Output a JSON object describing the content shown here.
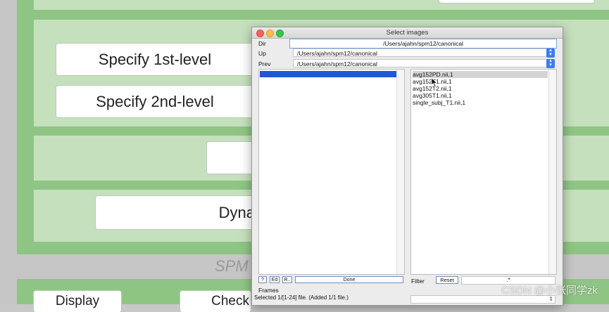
{
  "spm_panel": {
    "buttons": {
      "specify_1st": "Specify 1st-level",
      "specify_2nd": "Specify 2nd-level",
      "dyna": "Dyna",
      "display": "Display",
      "check": "Check"
    },
    "spm_label": "SPM"
  },
  "dialog": {
    "title": "Select images",
    "dir_label": "Dir",
    "dir_value": "/Users/ajahn/spm12/canonical",
    "up_label": "Up",
    "up_value": "/Users/ajahn/spm12/canonical",
    "prev_label": "Prev",
    "prev_value": "/Users/ajahn/spm12/canonical",
    "files": [
      "avg152PD.nii,1",
      "avg152T1.nii,1",
      "avg152T2.nii,1",
      "avg305T1.nii,1",
      "single_subj_T1.nii,1"
    ],
    "selected_file_index": 0,
    "help_button": "?",
    "ed_button": "Ed",
    "r_button": "R..",
    "done_button": "Done",
    "filter_label": "Filter",
    "reset_button": "Reset",
    "filter_value": ".*",
    "frames_label": "Frames",
    "status": "Selected 1/[1-24] file. (Added 1/1 file.)"
  },
  "watermark": "CSDN @小张同学zk",
  "colors": {
    "panel_green": "#8fc584",
    "box_green": "#c5e0bd",
    "selection_blue": "#1f57d6"
  }
}
